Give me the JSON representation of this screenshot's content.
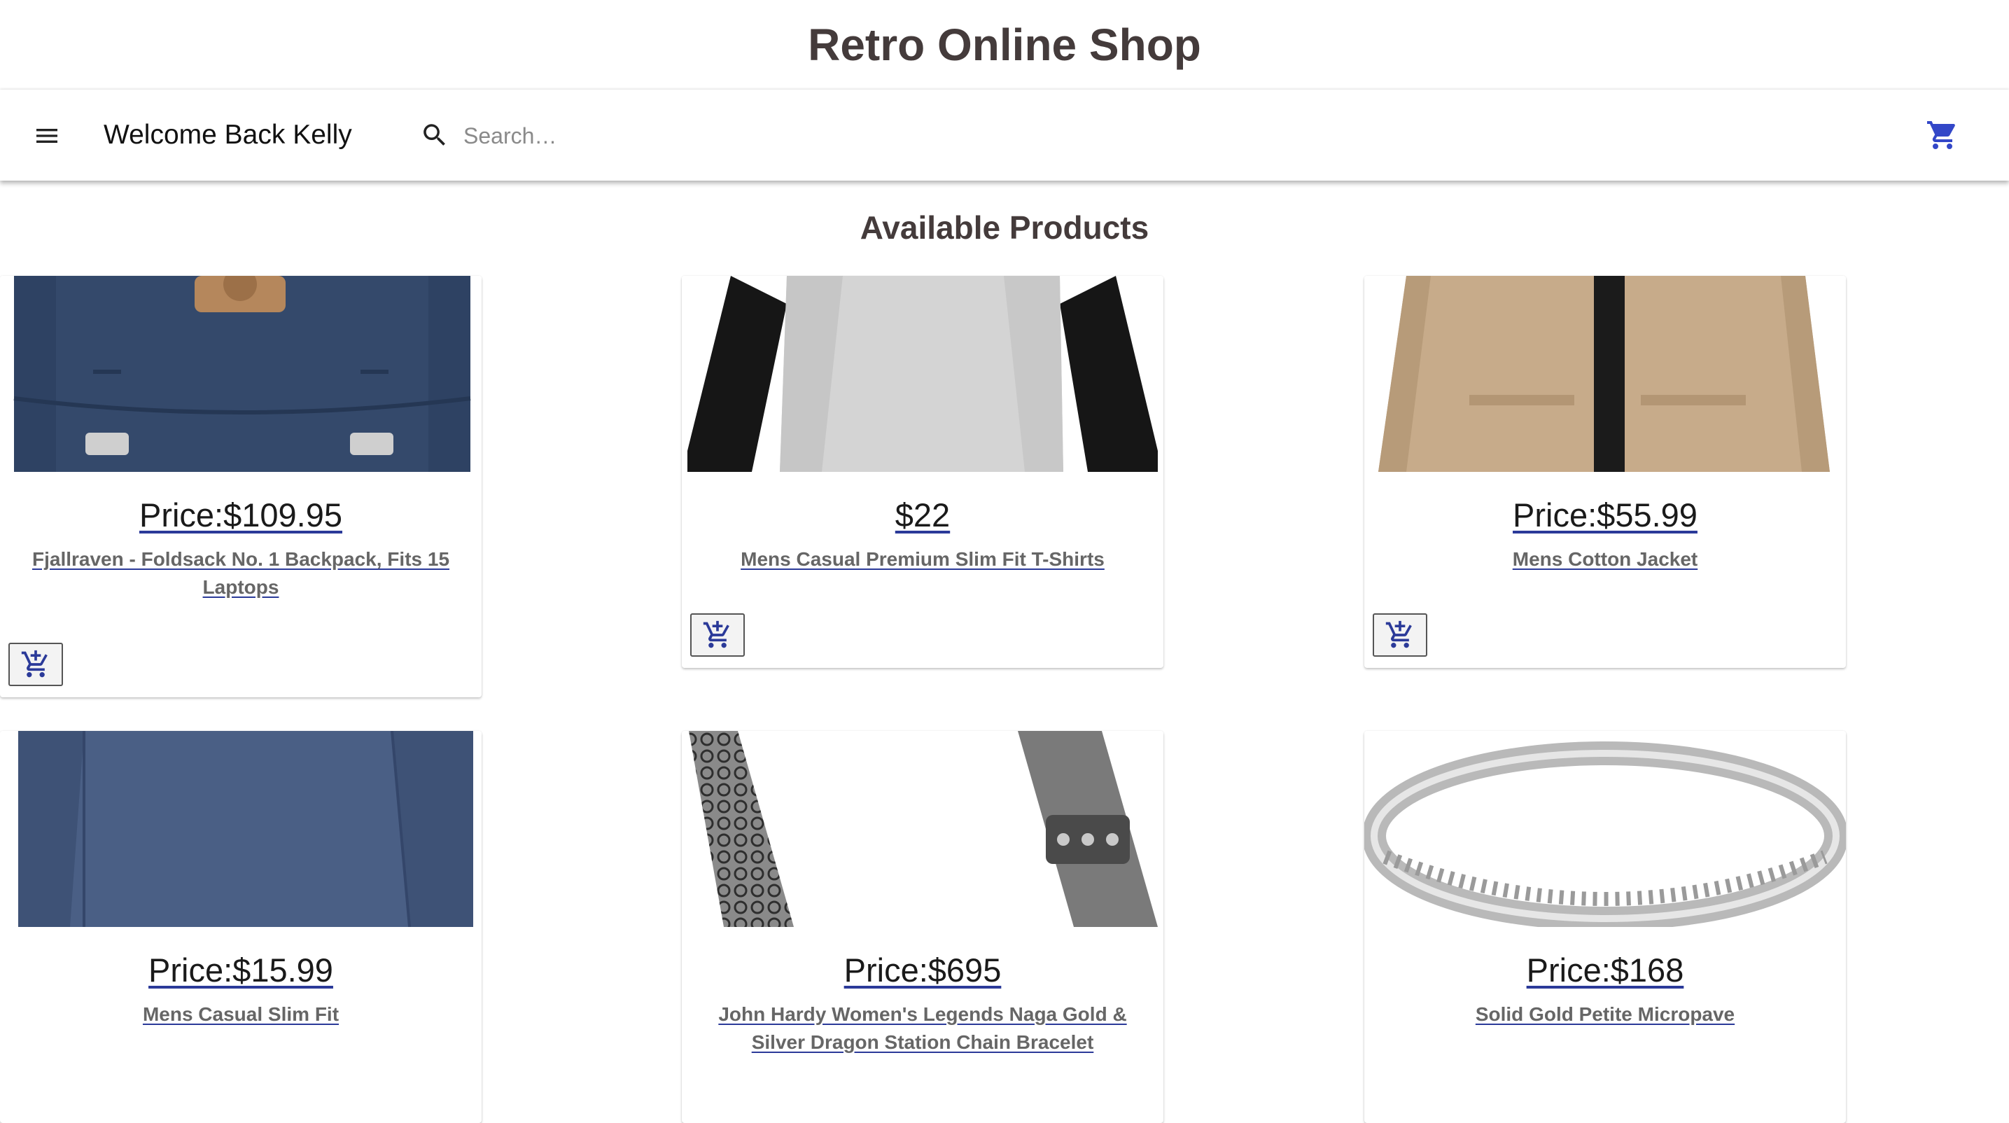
{
  "site": {
    "title": "Retro Online Shop"
  },
  "header": {
    "menu_icon": "menu-icon",
    "welcome": "Welcome Back Kelly",
    "search_icon": "search-icon",
    "search_placeholder": "Search…",
    "cart_icon": "cart-icon"
  },
  "main": {
    "section_title": "Available Products"
  },
  "products": [
    {
      "price": "Price:$109.95",
      "title": "Fjallraven - Foldsack No. 1 Backpack, Fits 15 Laptops",
      "image": "backpack"
    },
    {
      "price": "$22",
      "title": "Mens Casual Premium Slim Fit T-Shirts",
      "image": "tshirt"
    },
    {
      "price": "Price:$55.99",
      "title": "Mens Cotton Jacket",
      "image": "jacket"
    },
    {
      "price": "Price:$15.99",
      "title": "Mens Casual Slim Fit",
      "image": "longsleeve"
    },
    {
      "price": "Price:$695",
      "title": "John Hardy Women's Legends Naga Gold & Silver Dragon Station Chain Bracelet",
      "image": "bracelet"
    },
    {
      "price": "Price:$168",
      "title": "Solid Gold Petite Micropave",
      "image": "ring"
    }
  ],
  "colors": {
    "accent": "#2b3a99",
    "title_text": "#443b3b",
    "cart_icon": "#3347c8"
  }
}
